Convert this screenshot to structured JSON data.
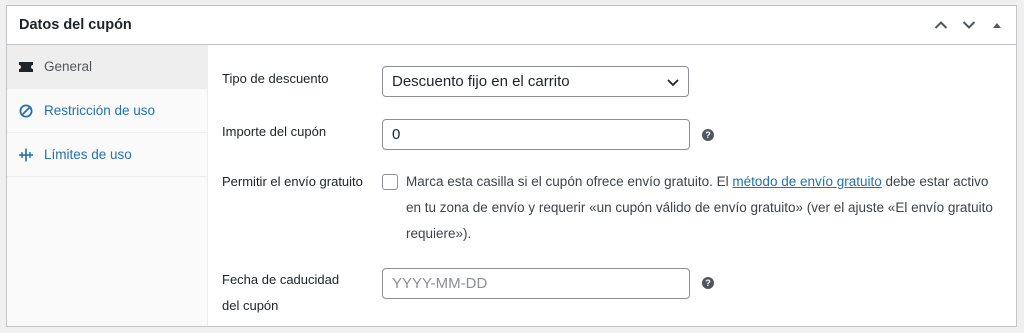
{
  "panel": {
    "title": "Datos del cupón"
  },
  "header_controls": {
    "move_up_icon": "chevron-up-icon",
    "move_down_icon": "chevron-down-icon",
    "toggle_icon": "triangle-up-icon"
  },
  "tabs": [
    {
      "label": "General",
      "icon": "ticket-icon",
      "active": true
    },
    {
      "label": "Restricción de uso",
      "icon": "no-entry-icon",
      "active": false
    },
    {
      "label": "Límites de uso",
      "icon": "limits-icon",
      "active": false
    }
  ],
  "fields": {
    "discount_type": {
      "label": "Tipo de descuento",
      "value": "Descuento fijo en el carrito"
    },
    "coupon_amount": {
      "label": "Importe del cupón",
      "value": "0"
    },
    "free_shipping": {
      "label": "Permitir el envío gratuito",
      "desc_before": "Marca esta casilla si el cupón ofrece envío gratuito. El ",
      "link_text": "método de envío gratuito",
      "desc_after": " debe estar activo en tu zona de envío y requerir «un cupón válido de envío gratuito» (ver el ajuste «El envío gratuito requiere»).",
      "checked": false
    },
    "expiry_date": {
      "label_line1": "Fecha de caducidad",
      "label_line2": "del cupón",
      "placeholder": "YYYY-MM-DD",
      "value": ""
    }
  },
  "help_glyph": "?",
  "colors": {
    "link": "#2271b1",
    "border": "#c3c4c7",
    "active_tab_bg": "#eeeeee",
    "help_icon": "#50575e"
  }
}
